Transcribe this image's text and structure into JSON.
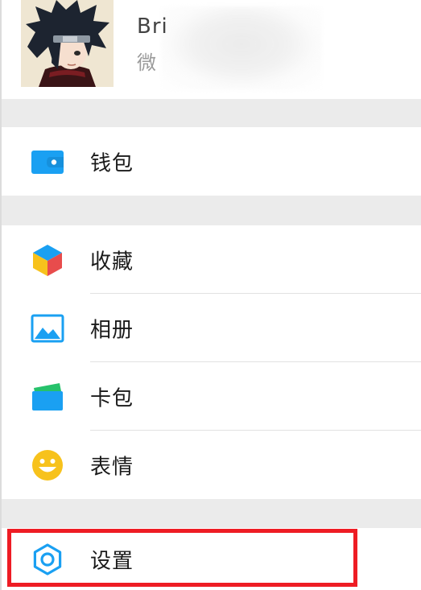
{
  "profile": {
    "name": "Bri",
    "subtitle": "微",
    "avatar_icon": "ninja-avatar"
  },
  "menu": {
    "wallet": {
      "label": "钱包",
      "icon": "wallet-icon",
      "color": "#1aa0f2"
    },
    "favorites": {
      "label": "收藏",
      "icon": "cube-icon",
      "colors": [
        "#e84c4c",
        "#f7c21c",
        "#1aa0f2"
      ]
    },
    "album": {
      "label": "相册",
      "icon": "picture-icon",
      "color": "#1aa0f2"
    },
    "cards": {
      "label": "卡包",
      "icon": "card-icon",
      "colors": [
        "#1aa0f2",
        "#26c26b"
      ]
    },
    "stickers": {
      "label": "表情",
      "icon": "smile-icon",
      "color": "#f7c21c"
    },
    "settings": {
      "label": "设置",
      "icon": "gear-icon",
      "color": "#1aa0f2"
    }
  },
  "highlight": {
    "color": "#ee1c24",
    "target": "settings"
  }
}
